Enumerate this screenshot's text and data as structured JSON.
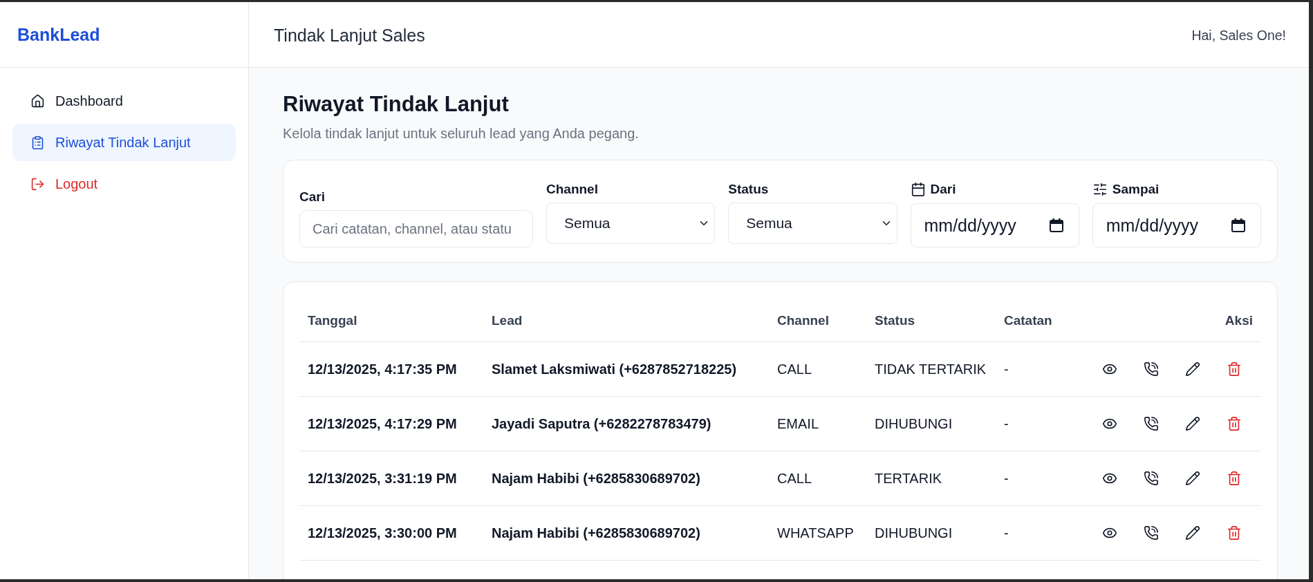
{
  "sidebar": {
    "brand": "BankLead",
    "items": [
      {
        "kind": "dashboard",
        "label": "Dashboard",
        "selected": false
      },
      {
        "kind": "history",
        "label": "Riwayat Tindak Lanjut",
        "selected": true
      },
      {
        "kind": "logout",
        "label": "Logout",
        "selected": false
      }
    ]
  },
  "header": {
    "title": "Tindak Lanjut Sales",
    "greeting": "Hai, Sales One!"
  },
  "page": {
    "title": "Riwayat Tindak Lanjut",
    "subtitle": "Kelola tindak lanjut untuk seluruh lead yang Anda pegang."
  },
  "filters": {
    "search": {
      "label": "Cari",
      "placeholder": "Cari catatan, channel, atau statu"
    },
    "channel": {
      "label": "Channel",
      "value": "Semua"
    },
    "status": {
      "label": "Status",
      "value": "Semua"
    },
    "date_from": {
      "label": "Dari",
      "placeholder": "mm/dd/yyyy"
    },
    "date_to": {
      "label": "Sampai",
      "placeholder": "mm/dd/yyyy"
    }
  },
  "table": {
    "columns": [
      "Tanggal",
      "Lead",
      "Channel",
      "Status",
      "Catatan",
      "Aksi"
    ],
    "rows": [
      {
        "date": "12/13/2025, 4:17:35 PM",
        "lead": "Slamet Laksmiwati (+6287852718225)",
        "channel": "CALL",
        "status": "TIDAK TERTARIK",
        "note": "-"
      },
      {
        "date": "12/13/2025, 4:17:29 PM",
        "lead": "Jayadi Saputra (+6282278783479)",
        "channel": "EMAIL",
        "status": "DIHUBUNGI",
        "note": "-"
      },
      {
        "date": "12/13/2025, 3:31:19 PM",
        "lead": "Najam Habibi (+6285830689702)",
        "channel": "CALL",
        "status": "TERTARIK",
        "note": "-"
      },
      {
        "date": "12/13/2025, 3:30:00 PM",
        "lead": "Najam Habibi (+6285830689702)",
        "channel": "WHATSAPP",
        "status": "DIHUBUNGI",
        "note": "-"
      }
    ]
  }
}
